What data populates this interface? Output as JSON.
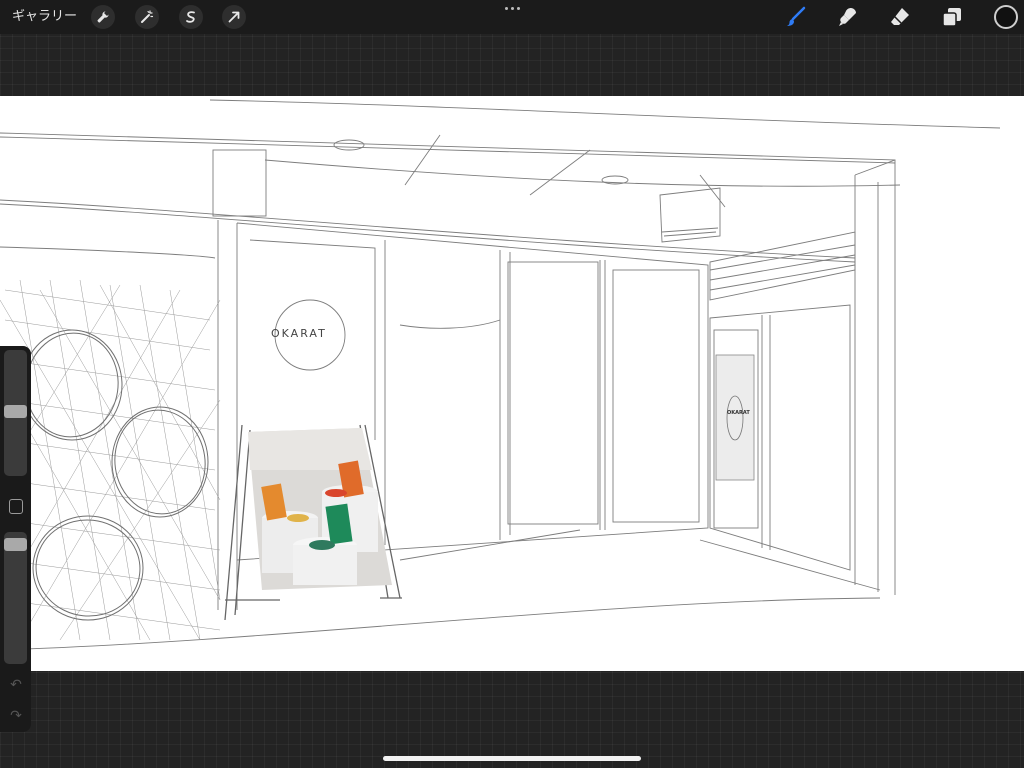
{
  "topbar": {
    "gallery_label": "ギャラリー",
    "left_tools": [
      "wrench-icon",
      "magic-wand-icon",
      "selection-icon",
      "transform-arrow-icon"
    ],
    "right_tools": [
      "brush-icon",
      "smudge-icon",
      "eraser-icon",
      "layers-icon"
    ],
    "active_tool": "brush-icon",
    "accent_color": "#2f7cf6",
    "current_color": "#111111"
  },
  "canvas": {
    "sign_text": "OKARAT",
    "door_sign_text": "OKARAT"
  },
  "sidebar": {
    "brush_size_level": 0.45,
    "opacity_level": 0.96
  }
}
